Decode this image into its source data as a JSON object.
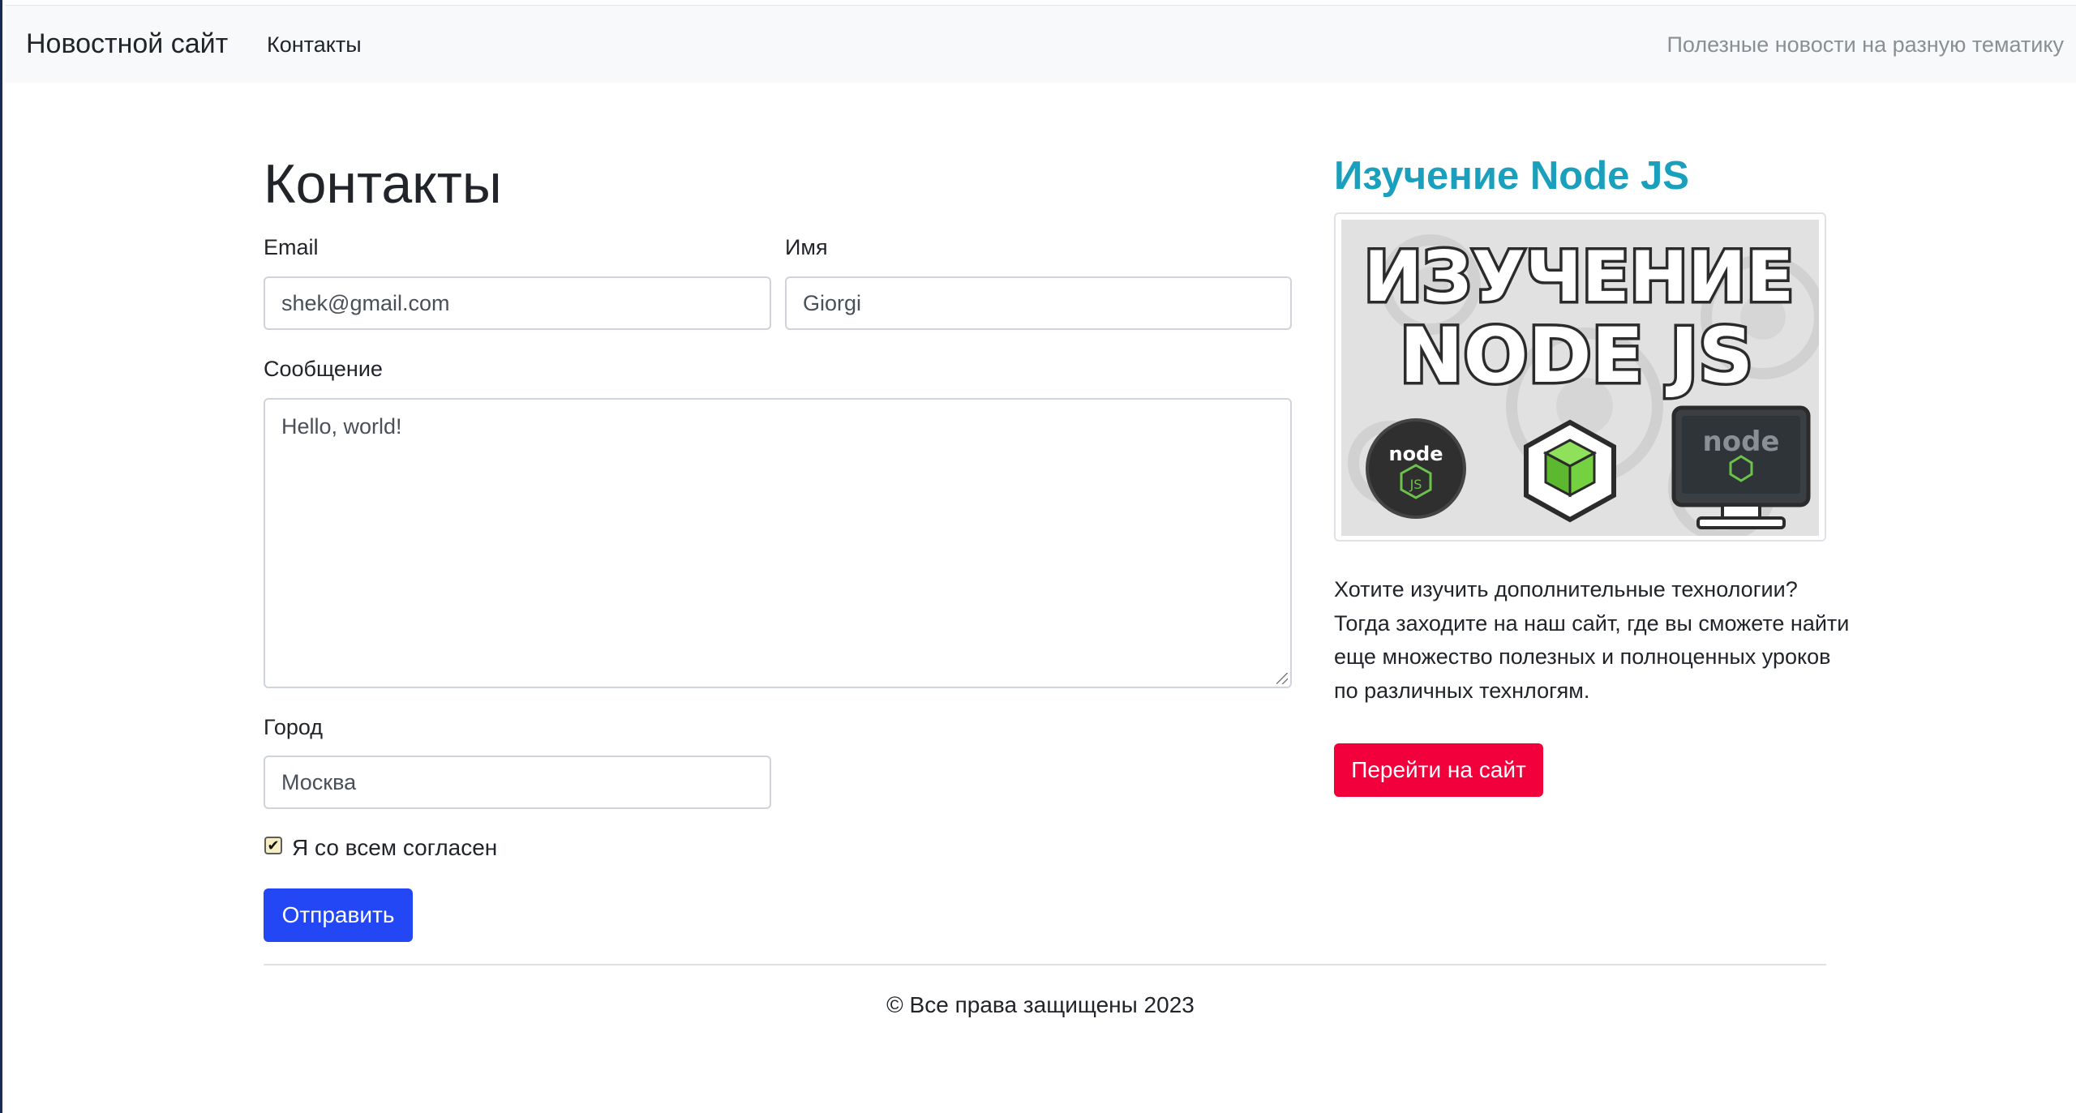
{
  "navbar": {
    "brand": "Новостной сайт",
    "link_contacts": "Контакты",
    "tagline": "Полезные новости на разную тематику"
  },
  "form": {
    "title": "Контакты",
    "email_label": "Email",
    "email_value": "shek@gmail.com",
    "name_label": "Имя",
    "name_value": "Giorgi",
    "message_label": "Сообщение",
    "message_value": "Hello, world!",
    "city_label": "Город",
    "city_value": "Москва",
    "agree_label": "Я со всем согласен",
    "agree_checked": true,
    "submit_label": "Отправить"
  },
  "sidebar": {
    "title": "Изучение Node JS",
    "image_text_line1": "ИЗУЧЕНИЕ",
    "image_text_line2": "NODE JS",
    "description": "Хотите изучить дополнительные технологии? Тогда заходите на наш сайт, где вы сможете найти еще множество полезных и полноценных уроков по различных технлогям.",
    "button_label": "Перейти на сайт"
  },
  "footer": {
    "copyright": "© Все права защищены 2023"
  },
  "colors": {
    "primary": "#2347f5",
    "danger": "#f2003c",
    "sidebar_title": "#1aa0bd",
    "navbar_bg": "#f8f9fa"
  }
}
